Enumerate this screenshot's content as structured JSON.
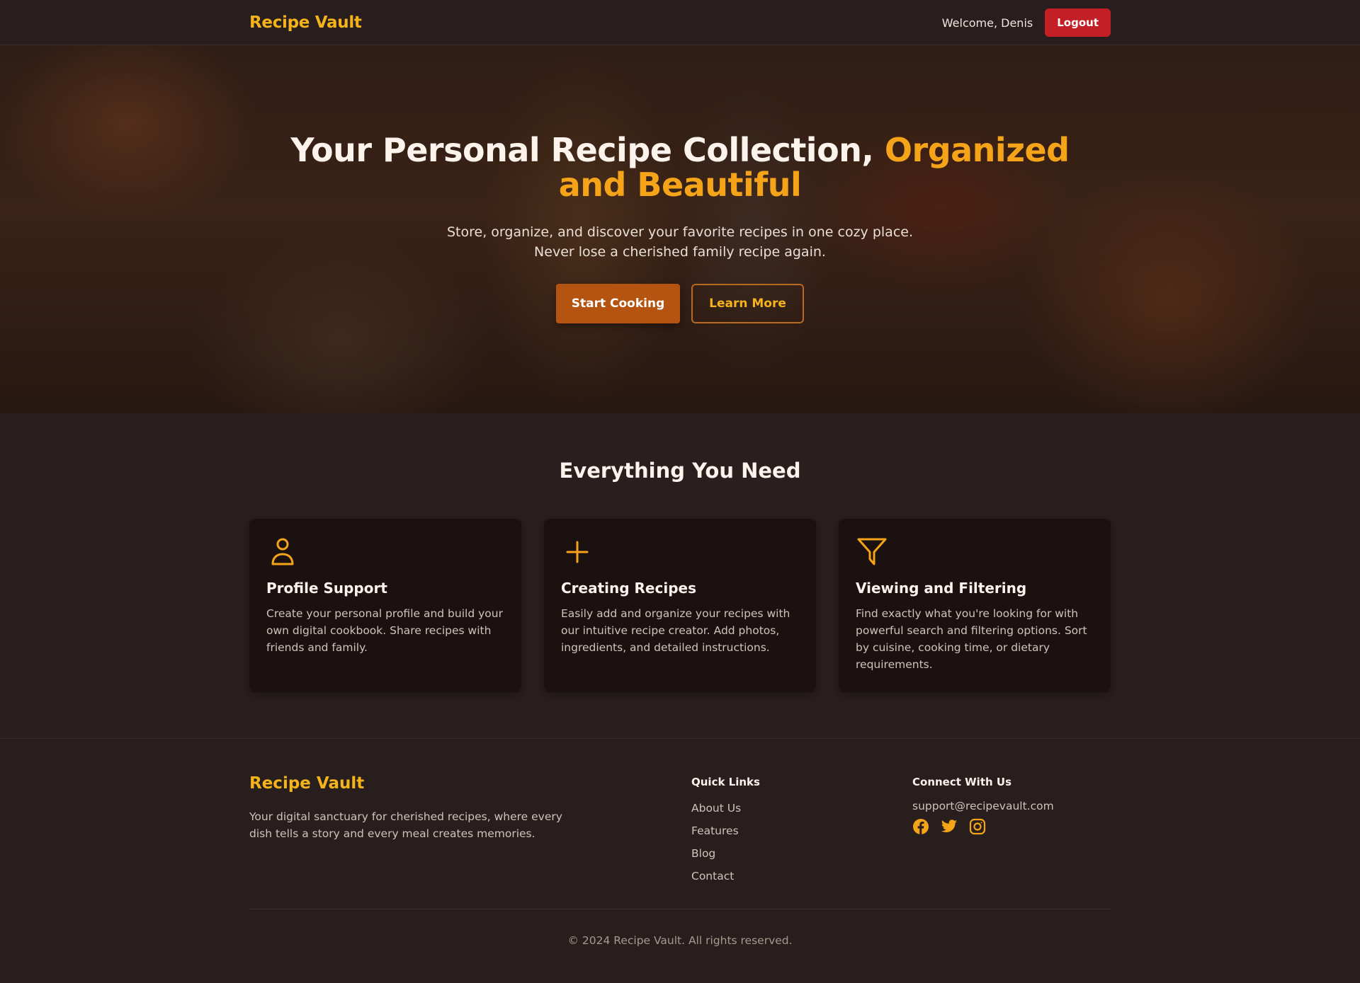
{
  "nav": {
    "brand": "Recipe Vault",
    "welcome": "Welcome, Denis",
    "logout_label": "Logout"
  },
  "hero": {
    "title_main": "Your Personal Recipe Collection, ",
    "title_accent": "Organized and Beautiful",
    "subtitle_line1": "Store, organize, and discover your favorite recipes in one cozy place.",
    "subtitle_line2": "Never lose a cherished family recipe again.",
    "primary_label": "Start Cooking",
    "secondary_label": "Learn More"
  },
  "features": {
    "title": "Everything You Need",
    "cards": [
      {
        "icon": "user-icon",
        "title": "Profile Support",
        "desc": "Create your personal profile and build your own digital cookbook. Share recipes with friends and family."
      },
      {
        "icon": "plus-icon",
        "title": "Creating Recipes",
        "desc": "Easily add and organize your recipes with our intuitive recipe creator. Add photos, ingredients, and detailed instructions."
      },
      {
        "icon": "filter-icon",
        "title": "Viewing and Filtering",
        "desc": "Find exactly what you're looking for with powerful search and filtering options. Sort by cuisine, cooking time, or dietary requirements."
      }
    ]
  },
  "footer": {
    "brand": "Recipe Vault",
    "tagline": "Your digital sanctuary for cherished recipes, where every dish tells a story and every meal creates memories.",
    "quick_links_title": "Quick Links",
    "quick_links": [
      "About Us",
      "Features",
      "Blog",
      "Contact"
    ],
    "connect_title": "Connect With Us",
    "email": "support@recipevault.com",
    "socials": [
      "facebook-icon",
      "twitter-icon",
      "instagram-icon"
    ],
    "copyright": "© 2024 Recipe Vault. All rights reserved."
  },
  "colors": {
    "accent": "#f5a41a",
    "brand": "#f5b31b",
    "logout": "#c31f27",
    "primary_button": "#b55310",
    "background": "#2a1f1e",
    "card": "#1b1111"
  }
}
